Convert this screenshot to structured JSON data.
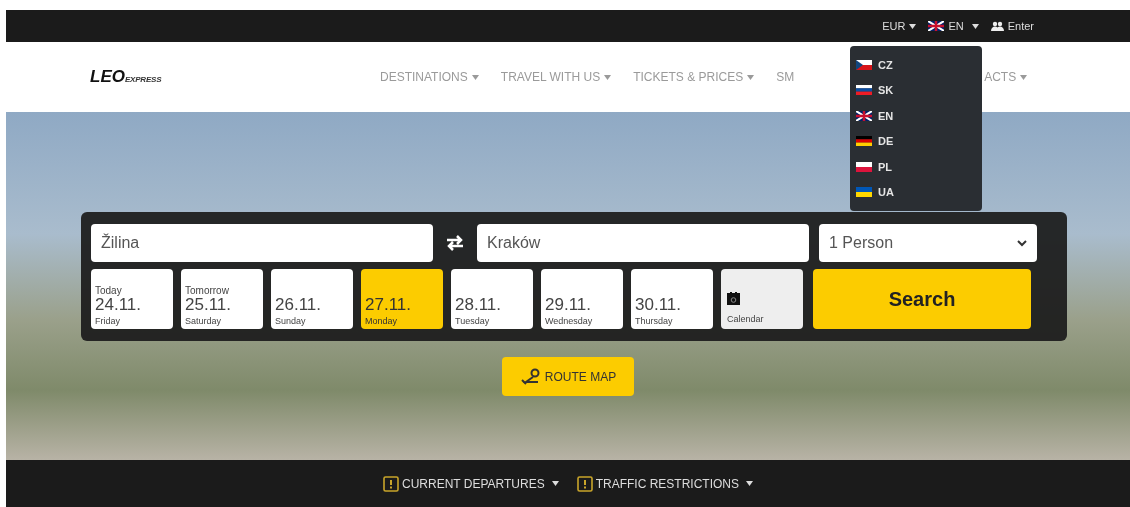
{
  "top_bar": {
    "currency": "EUR",
    "language": "EN",
    "login": "Enter"
  },
  "language_menu": [
    {
      "code": "CZ",
      "kind": "cz"
    },
    {
      "code": "SK",
      "kind": "sk"
    },
    {
      "code": "EN",
      "kind": "gb"
    },
    {
      "code": "DE",
      "kind": "de"
    },
    {
      "code": "PL",
      "kind": "pl"
    },
    {
      "code": "UA",
      "kind": "ua"
    }
  ],
  "logo": {
    "main": "LEO",
    "sub": "EXPRESS"
  },
  "nav": [
    {
      "label": "DESTINATIONS",
      "caret": true
    },
    {
      "label": "TRAVEL WITH US",
      "caret": true
    },
    {
      "label": "TICKETS & PRICES",
      "caret": true
    },
    {
      "label": "SM",
      "caret": false
    },
    {
      "label": "ACTS",
      "caret": true
    }
  ],
  "search": {
    "from": "Žilina",
    "to": "Kraków",
    "passengers": "1 Person",
    "button": "Search",
    "calendar": "Calendar"
  },
  "dates": [
    {
      "top": "Today",
      "date": "24.11.",
      "day": "Friday",
      "selected": false
    },
    {
      "top": "Tomorrow",
      "date": "25.11.",
      "day": "Saturday",
      "selected": false
    },
    {
      "date": "26.11.",
      "day": "Sunday",
      "selected": false
    },
    {
      "date": "27.11.",
      "day": "Monday",
      "selected": true
    },
    {
      "date": "28.11.",
      "day": "Tuesday",
      "selected": false
    },
    {
      "date": "29.11.",
      "day": "Wednesday",
      "selected": false
    },
    {
      "date": "30.11.",
      "day": "Thursday",
      "selected": false
    }
  ],
  "route_map": "ROUTE MAP",
  "bottom_bar": [
    "CURRENT DEPARTURES",
    "TRAFFIC RESTRICTIONS"
  ]
}
